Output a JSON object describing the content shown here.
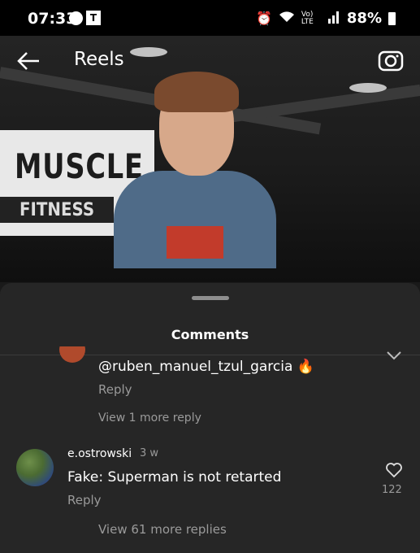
{
  "status_bar": {
    "time": "07:33",
    "app_icon_letter": "T",
    "network": "Vo) LTE",
    "battery_percent": "88%"
  },
  "header": {
    "title": "Reels"
  },
  "video": {
    "sign_text": "MUSCLE",
    "sign_subtext": "FITNESS"
  },
  "sheet": {
    "title": "Comments"
  },
  "comments": [
    {
      "text": "@ruben_manuel_tzul_garcia 🔥",
      "reply_label": "Reply",
      "more_replies": "View 1 more reply"
    },
    {
      "username": "e.ostrowski",
      "time": "3 w",
      "text": "Fake: Superman is not retarted",
      "reply_label": "Reply",
      "more_replies": "View 61 more replies",
      "likes": "122"
    }
  ],
  "icons": {
    "back": "back-arrow-icon",
    "camera": "camera-icon",
    "heart": "heart-icon",
    "alarm": "alarm-icon",
    "wifi": "wifi-icon",
    "signal": "signal-icon",
    "battery": "battery-icon",
    "messenger": "messenger-icon"
  }
}
